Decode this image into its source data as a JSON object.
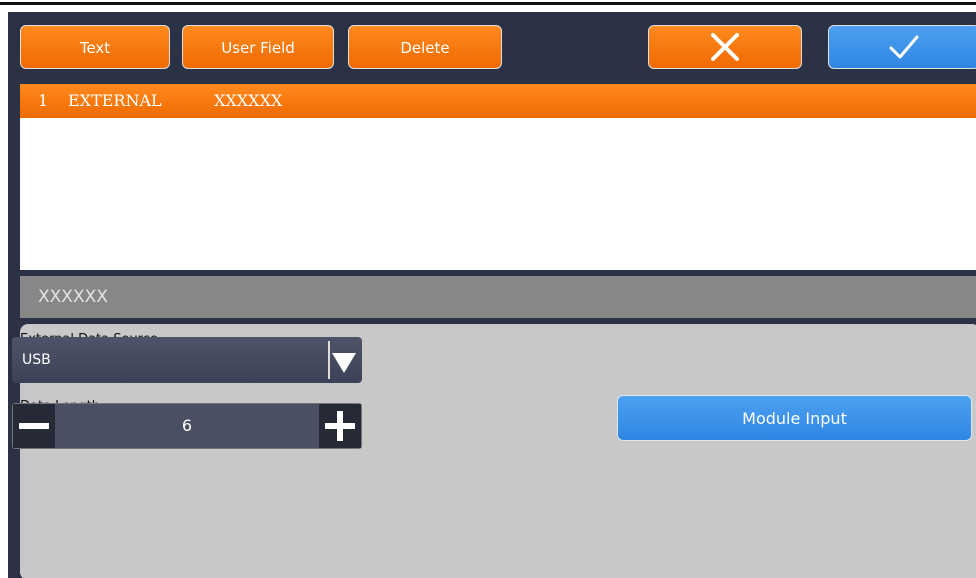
{
  "toolbar": {
    "text_label": "Text",
    "user_field_label": "User Field",
    "delete_label": "Delete",
    "cancel_icon": "close-icon",
    "confirm_icon": "check-icon"
  },
  "list": {
    "rows": [
      {
        "index": "1",
        "type": "EXTERNAL",
        "value": "XXXXXX",
        "selected": true
      }
    ]
  },
  "preview": {
    "text": "XXXXXX"
  },
  "settings": {
    "source_label": "External Data Source",
    "source_value": "USB",
    "length_label": "Data Length",
    "length_value": "6",
    "module_input_label": "Module Input"
  },
  "colors": {
    "accent_orange": "#f57c00",
    "accent_blue": "#3a8ee6",
    "frame": "#2b3245"
  }
}
